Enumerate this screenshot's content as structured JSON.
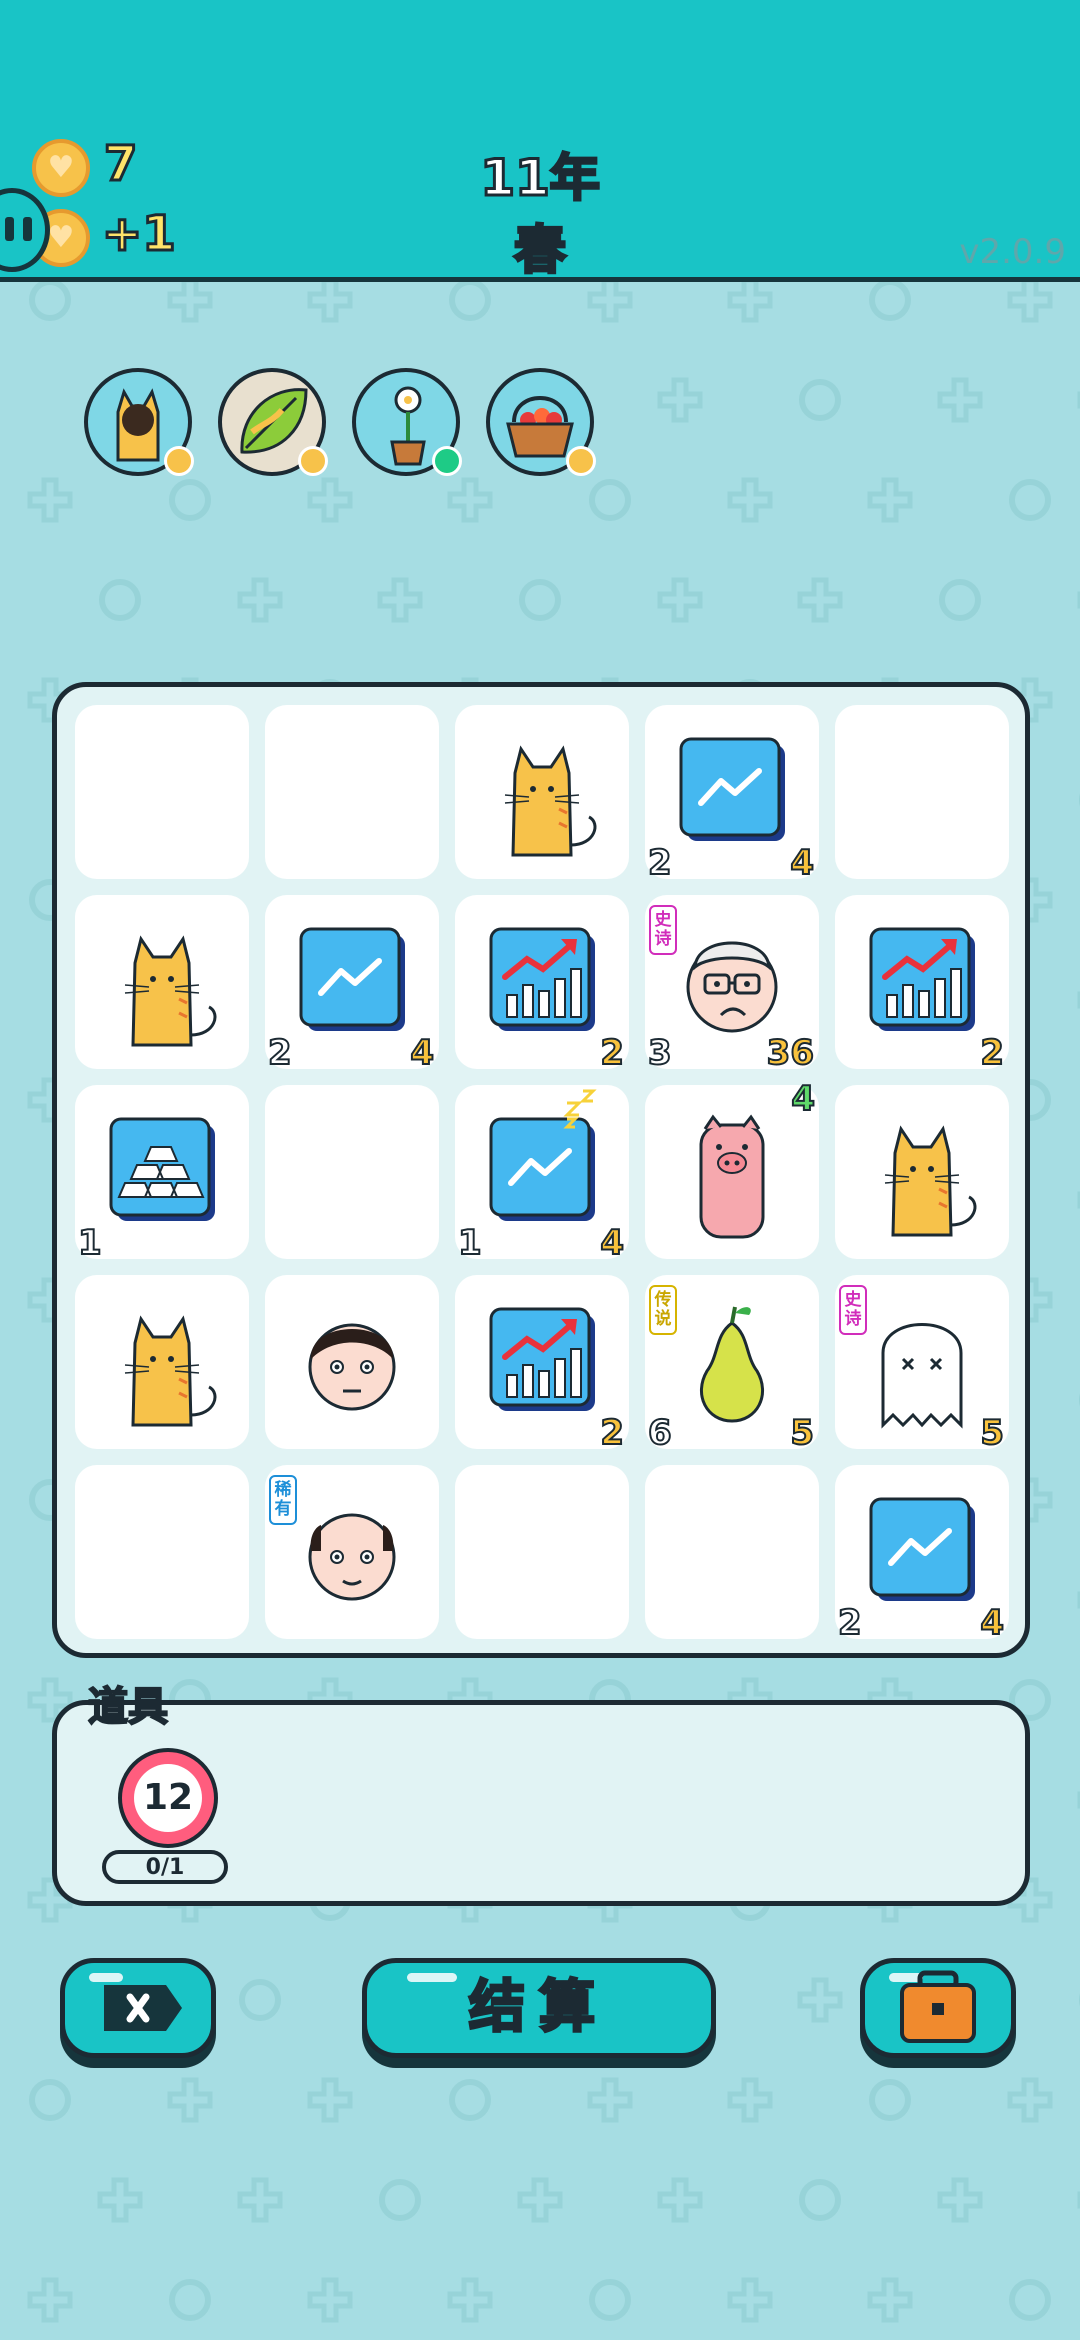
{
  "header": {
    "coins": "7",
    "coins_per_turn": "+1",
    "year": "11年",
    "season": "春",
    "version": "v2.0.9",
    "pause_icon": "pause-icon"
  },
  "relics": [
    {
      "name": "cat-relic-icon",
      "badge": "coin"
    },
    {
      "name": "leaf-relic-icon",
      "badge": "coin"
    },
    {
      "name": "flower-pot-relic-icon",
      "badge": "green"
    },
    {
      "name": "fruit-basket-relic-icon",
      "badge": "coin"
    }
  ],
  "board": [
    [
      {
        "icon": "empty"
      },
      {
        "icon": "empty"
      },
      {
        "icon": "cat-icon"
      },
      {
        "icon": "trend-up-card-icon",
        "left": "2",
        "right": "4"
      },
      {
        "icon": "empty"
      }
    ],
    [
      {
        "icon": "cat-icon"
      },
      {
        "icon": "trend-up-card-icon",
        "left": "2",
        "right": "4"
      },
      {
        "icon": "bar-chart-card-icon",
        "right": "2"
      },
      {
        "icon": "old-man-glasses-icon",
        "tag": "史诗",
        "left": "3",
        "right": "36"
      },
      {
        "icon": "bar-chart-card-icon",
        "right": "2"
      }
    ],
    [
      {
        "icon": "gold-bars-card-icon",
        "left": "1"
      },
      {
        "icon": "empty"
      },
      {
        "icon": "trend-up-card-sleeping-icon",
        "left": "1",
        "right": "4"
      },
      {
        "icon": "pig-icon",
        "top": "4"
      },
      {
        "icon": "cat-icon"
      }
    ],
    [
      {
        "icon": "cat-icon"
      },
      {
        "icon": "man-face-icon"
      },
      {
        "icon": "bar-chart-card-icon",
        "right": "2"
      },
      {
        "icon": "pear-icon",
        "tag": "传说",
        "left": "6",
        "right": "5"
      },
      {
        "icon": "ghost-icon",
        "tag": "史诗",
        "right": "5"
      }
    ],
    [
      {
        "icon": "empty"
      },
      {
        "icon": "bald-man-face-icon",
        "tag": "稀有"
      },
      {
        "icon": "empty"
      },
      {
        "icon": "empty"
      },
      {
        "icon": "trend-up-card-icon",
        "left": "2",
        "right": "4"
      }
    ]
  ],
  "props": {
    "title": "道具",
    "item_value": "12",
    "item_count": "0/1",
    "item_icon": "target-item-icon"
  },
  "buttons": {
    "exit_icon": "close-tag-icon",
    "settle_label": "结算",
    "bag_icon": "briefcase-icon"
  },
  "colors": {
    "header": "#19c4c6",
    "background": "#a6dde3",
    "outline": "#1c2a33",
    "coin": "#f7c24a"
  }
}
